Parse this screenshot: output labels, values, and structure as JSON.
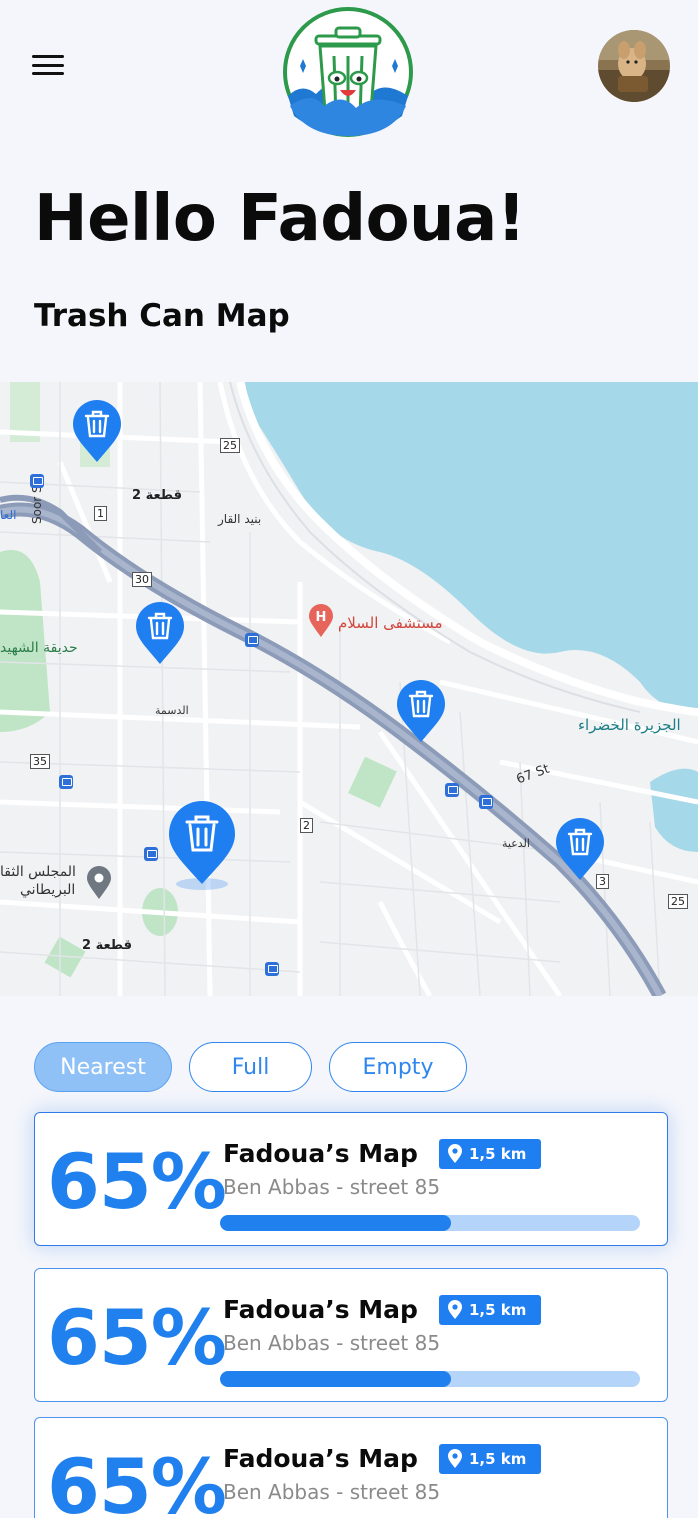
{
  "header": {
    "menu_icon": "hamburger-menu-icon",
    "logo_icon": "trash-can-logo",
    "avatar_icon": "user-avatar"
  },
  "greeting": "Hello Fadoua!",
  "section_title": "Trash Can Map",
  "map": {
    "labels": {
      "block2_top": "قطعة 2",
      "block2_bottom": "قطعة 2",
      "bneid_alqar": "بنيد القار",
      "dasma": "الدسمة",
      "daiya": "الدعية",
      "hospital": "مستشفى السلام",
      "green_island": "الجزيرة الخضراء",
      "martyrs_park": "حديقة الشهيد",
      "british_council_1": "المجلس الثقا",
      "british_council_2": "البريطاني",
      "soor_st": "Soor St",
      "st67": "67 St",
      "edge_left": "العا"
    },
    "road_signs": [
      "25",
      "1",
      "30",
      "35",
      "2",
      "3",
      "25"
    ],
    "pin_icon": "trash-pin-icon",
    "hospital_icon": "hospital-marker-icon",
    "place_icon": "place-marker-icon",
    "bus_icon": "bus-stop-icon"
  },
  "filters": {
    "nearest": "Nearest",
    "full": "Full",
    "empty": "Empty",
    "active": "nearest"
  },
  "cards": [
    {
      "percent": "65%",
      "name": "Fadoua’s Map",
      "address": "Ben Abbas - street 85",
      "distance": "1,5 km",
      "fill": 0.55
    },
    {
      "percent": "65%",
      "name": "Fadoua’s Map",
      "address": "Ben Abbas - street 85",
      "distance": "1,5 km",
      "fill": 0.55
    },
    {
      "percent": "65%",
      "name": "Fadoua’s Map",
      "address": "Ben Abbas - street 85",
      "distance": "1,5 km",
      "fill": 0.55
    }
  ],
  "colors": {
    "accent": "#1f80ee",
    "bar_track": "#b5d4fa",
    "water": "#a5d8e8",
    "pin": "#1f7ef0"
  }
}
